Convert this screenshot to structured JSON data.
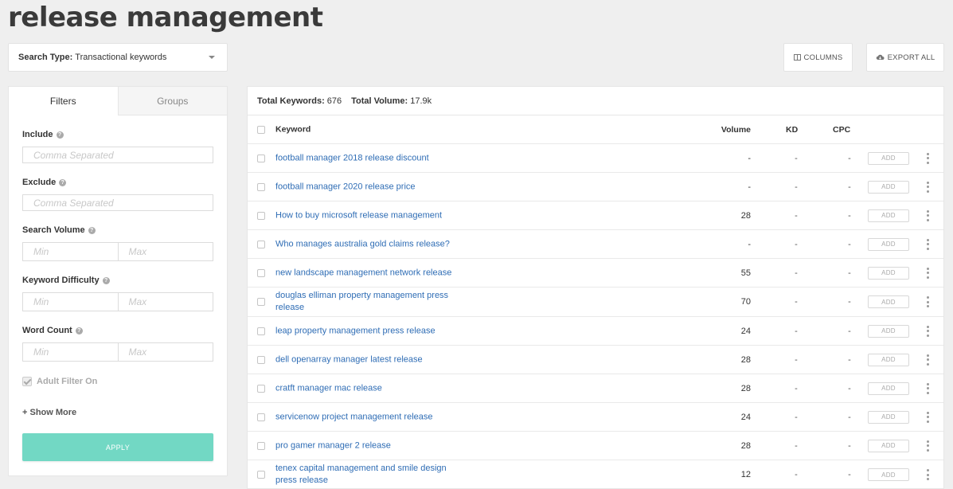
{
  "page": {
    "title": "release management"
  },
  "search_type": {
    "label": "Search Type:",
    "value": "Transactional keywords",
    "icon": "chevron-down-icon"
  },
  "toolbar": {
    "columns_label": "COLUMNS",
    "columns_icon": "columns-icon",
    "export_label": "EXPORT ALL",
    "export_icon": "cloud-download-icon"
  },
  "filters": {
    "tabs": [
      {
        "label": "Filters",
        "active": true
      },
      {
        "label": "Groups",
        "active": false
      }
    ],
    "include": {
      "label": "Include",
      "placeholder": "Comma Separated"
    },
    "exclude": {
      "label": "Exclude",
      "placeholder": "Comma Separated"
    },
    "search_volume": {
      "label": "Search Volume",
      "min": "Min",
      "max": "Max"
    },
    "keyword_difficulty": {
      "label": "Keyword Difficulty",
      "min": "Min",
      "max": "Max"
    },
    "word_count": {
      "label": "Word Count",
      "min": "Min",
      "max": "Max"
    },
    "adult_filter": {
      "label": "Adult Filter On",
      "checked": true
    },
    "show_more": "+ Show More",
    "apply": "APPLY"
  },
  "results": {
    "total_keywords_label": "Total Keywords:",
    "total_keywords": "676",
    "total_volume_label": "Total Volume:",
    "total_volume": "17.9k",
    "columns": {
      "keyword": "Keyword",
      "volume": "Volume",
      "kd": "KD",
      "cpc": "CPC"
    },
    "add_label": "ADD",
    "rows": [
      {
        "keyword": "football manager 2018 release discount",
        "volume": "-",
        "kd": "-",
        "cpc": "-"
      },
      {
        "keyword": "football manager 2020 release price",
        "volume": "-",
        "kd": "-",
        "cpc": "-"
      },
      {
        "keyword": "How to buy microsoft release management",
        "volume": "28",
        "kd": "-",
        "cpc": "-"
      },
      {
        "keyword": "Who manages australia gold claims release?",
        "volume": "-",
        "kd": "-",
        "cpc": "-"
      },
      {
        "keyword": "new landscape management network release",
        "volume": "55",
        "kd": "-",
        "cpc": "-"
      },
      {
        "keyword": "douglas elliman property management press release",
        "volume": "70",
        "kd": "-",
        "cpc": "-"
      },
      {
        "keyword": "leap property management press release",
        "volume": "24",
        "kd": "-",
        "cpc": "-"
      },
      {
        "keyword": "dell openarray manager latest release",
        "volume": "28",
        "kd": "-",
        "cpc": "-"
      },
      {
        "keyword": "cratft manager mac release",
        "volume": "28",
        "kd": "-",
        "cpc": "-"
      },
      {
        "keyword": "servicenow project management release",
        "volume": "24",
        "kd": "-",
        "cpc": "-"
      },
      {
        "keyword": "pro gamer manager 2 release",
        "volume": "28",
        "kd": "-",
        "cpc": "-"
      },
      {
        "keyword": "tenex capital management and smile design press release",
        "volume": "12",
        "kd": "-",
        "cpc": "-"
      }
    ]
  }
}
